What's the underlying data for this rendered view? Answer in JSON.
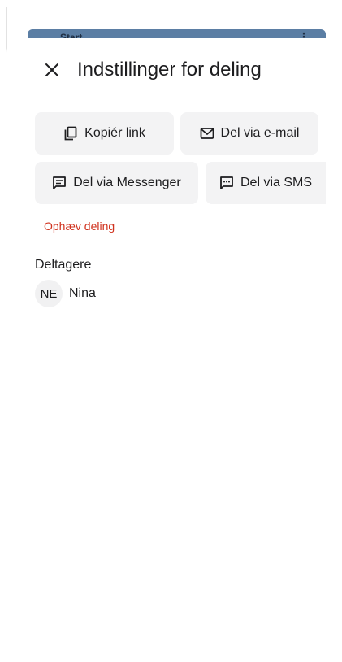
{
  "backdrop": {
    "back_label": "Start",
    "more_glyph": "⋮"
  },
  "sheet": {
    "close_icon": "close-icon",
    "title": "Indstillinger for deling",
    "actions": [
      {
        "icon": "copy-icon",
        "label": "Kopiér link"
      },
      {
        "icon": "mail-icon",
        "label": "Del via e-mail"
      },
      {
        "icon": "messenger-icon",
        "label": "Del via Messenger"
      },
      {
        "icon": "sms-icon",
        "label": "Del via SMS"
      }
    ],
    "unshare_label": "Ophæv deling",
    "participants_heading": "Deltagere",
    "participants": [
      {
        "initials": "NE",
        "name": "Nina"
      }
    ]
  },
  "colors": {
    "danger": "#d0321e",
    "button_bg": "#f3f3f4",
    "text": "#1d1d1f",
    "backdrop_bar": "#5b7ea4"
  }
}
